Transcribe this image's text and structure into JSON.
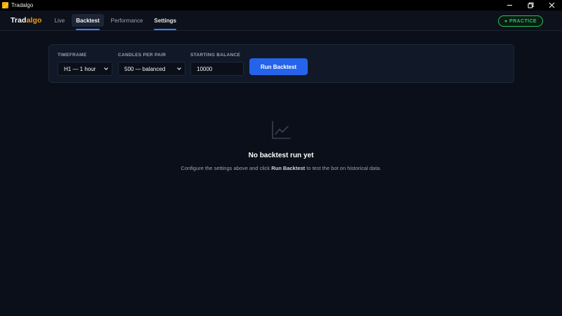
{
  "window": {
    "title": "Tradalgo",
    "controls": [
      "minimize-icon",
      "restore-icon",
      "close-icon"
    ]
  },
  "header": {
    "brand_part1": "Trad",
    "brand_part2": "algo",
    "tabs": [
      {
        "label": "Live"
      },
      {
        "label": "Backtest",
        "active": true
      },
      {
        "label": "Performance"
      },
      {
        "label": "Settings"
      }
    ],
    "mode_badge": "● PRACTICE"
  },
  "backtest": {
    "timeframe": {
      "label": "TIMEFRAME",
      "value": "H1 — 1 hour"
    },
    "candles": {
      "label": "CANDLES PER PAIR",
      "value": "500 — balanced"
    },
    "balance": {
      "label": "STARTING BALANCE",
      "value": "10000"
    },
    "run_label": "Run Backtest"
  },
  "empty_state": {
    "icon": "chart-line-icon",
    "title": "No backtest run yet",
    "desc_before": "Configure the settings above and click ",
    "desc_strong": "Run Backtest",
    "desc_after": " to test the bot on historical data."
  },
  "colors": {
    "background": "#0b0f19",
    "accent_blue": "#2563eb",
    "brand_orange": "#f59e0b",
    "practice_green": "#22c55e"
  }
}
